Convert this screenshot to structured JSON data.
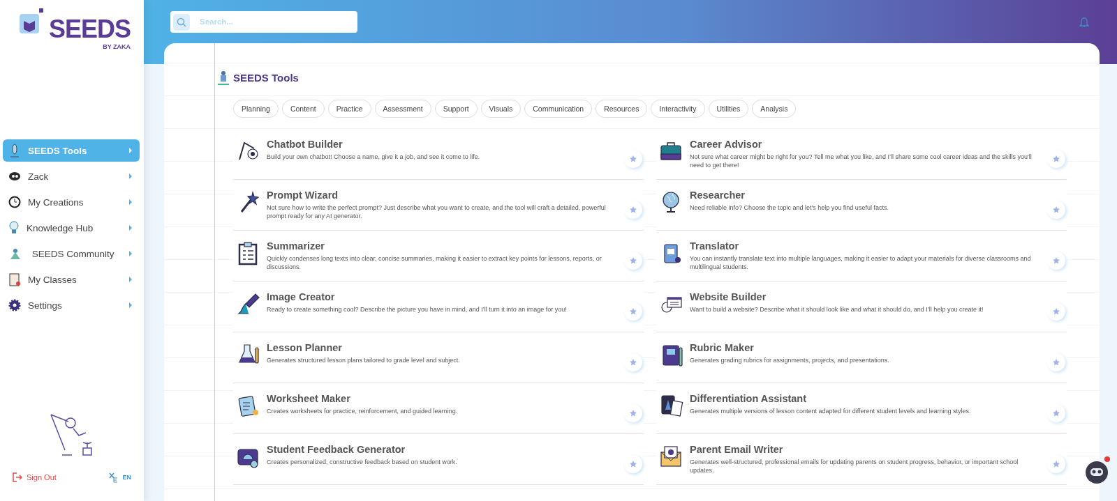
{
  "logo": {
    "title": "SEEDS",
    "subtitle": "BY ZAKA"
  },
  "sidebar": {
    "items": [
      {
        "label": "SEEDS Tools",
        "selected": true
      },
      {
        "label": "Zack",
        "selected": false
      },
      {
        "label": "My Creations",
        "selected": false
      },
      {
        "label": "Knowledge Hub",
        "selected": false
      },
      {
        "label": " SEEDS Community",
        "selected": false
      },
      {
        "label": "My Classes",
        "selected": false
      },
      {
        "label": "Settings",
        "selected": false
      }
    ],
    "sign_out": "Sign Out",
    "language": "EN"
  },
  "search": {
    "placeholder": "Search..."
  },
  "page_title": "SEEDS Tools",
  "filters": [
    {
      "label": "Planning",
      "selected": false
    },
    {
      "label": "Content",
      "selected": false
    },
    {
      "label": "Practice",
      "selected": false
    },
    {
      "label": "Assessment",
      "selected": false
    },
    {
      "label": "Support",
      "selected": false
    },
    {
      "label": "Visuals",
      "selected": false
    },
    {
      "label": "Communication",
      "selected": false
    },
    {
      "label": "Resources",
      "selected": false
    },
    {
      "label": "Interactivity",
      "selected": false
    },
    {
      "label": "Utilities",
      "selected": false
    },
    {
      "label": "Analysis",
      "selected": false
    }
  ],
  "tools": [
    {
      "title": "Chatbot Builder",
      "description": "Build your own chatbot! Choose a name, give it a job, and see it come to life."
    },
    {
      "title": "Career Advisor",
      "description": "Not sure what career might be right for you? Tell me what you like, and I’ll share some cool career ideas and the skills you'll need to get there!"
    },
    {
      "title": "Prompt Wizard",
      "description": "Not sure how to write the perfect prompt? Just describe what you want to create, and the tool will craft a detailed, powerful prompt ready for any AI generator."
    },
    {
      "title": "Researcher",
      "description": "Need reliable info? Choose the topic and let's help you find useful facts."
    },
    {
      "title": "Summarizer",
      "description": "Quickly condenses long texts into clear, concise summaries, making it easier to extract key points for lessons, reports, or discussions."
    },
    {
      "title": "Translator",
      "description": "You can instantly translate text into multiple languages, making it easier to adapt your materials for diverse classrooms and multilingual students."
    },
    {
      "title": "Image Creator",
      "description": "Ready to create something cool? Describe the picture you have in mind, and I’ll turn it into an image for you!"
    },
    {
      "title": "Website Builder",
      "description": "Want to build a website? Describe what it should look like and what it should do, and I’ll help you create it!"
    },
    {
      "title": "Lesson Planner",
      "description": "Generates structured lesson plans tailored to grade level and subject."
    },
    {
      "title": "Rubric Maker",
      "description": "Generates grading rubrics for assignments, projects, and presentations."
    },
    {
      "title": "Worksheet Maker",
      "description": "Creates worksheets for practice, reinforcement, and guided learning."
    },
    {
      "title": "Differentiation Assistant",
      "description": "Generates multiple versions of lesson content adapted for different student levels and learning styles."
    },
    {
      "title": "Student Feedback Generator",
      "description": "Creates personalized, constructive feedback based on student work."
    },
    {
      "title": "Parent Email Writer",
      "description": "Generates well-structured, professional emails for updating parents on student progress, behavior, or important school updates."
    }
  ],
  "assistant": {
    "notification": true
  }
}
